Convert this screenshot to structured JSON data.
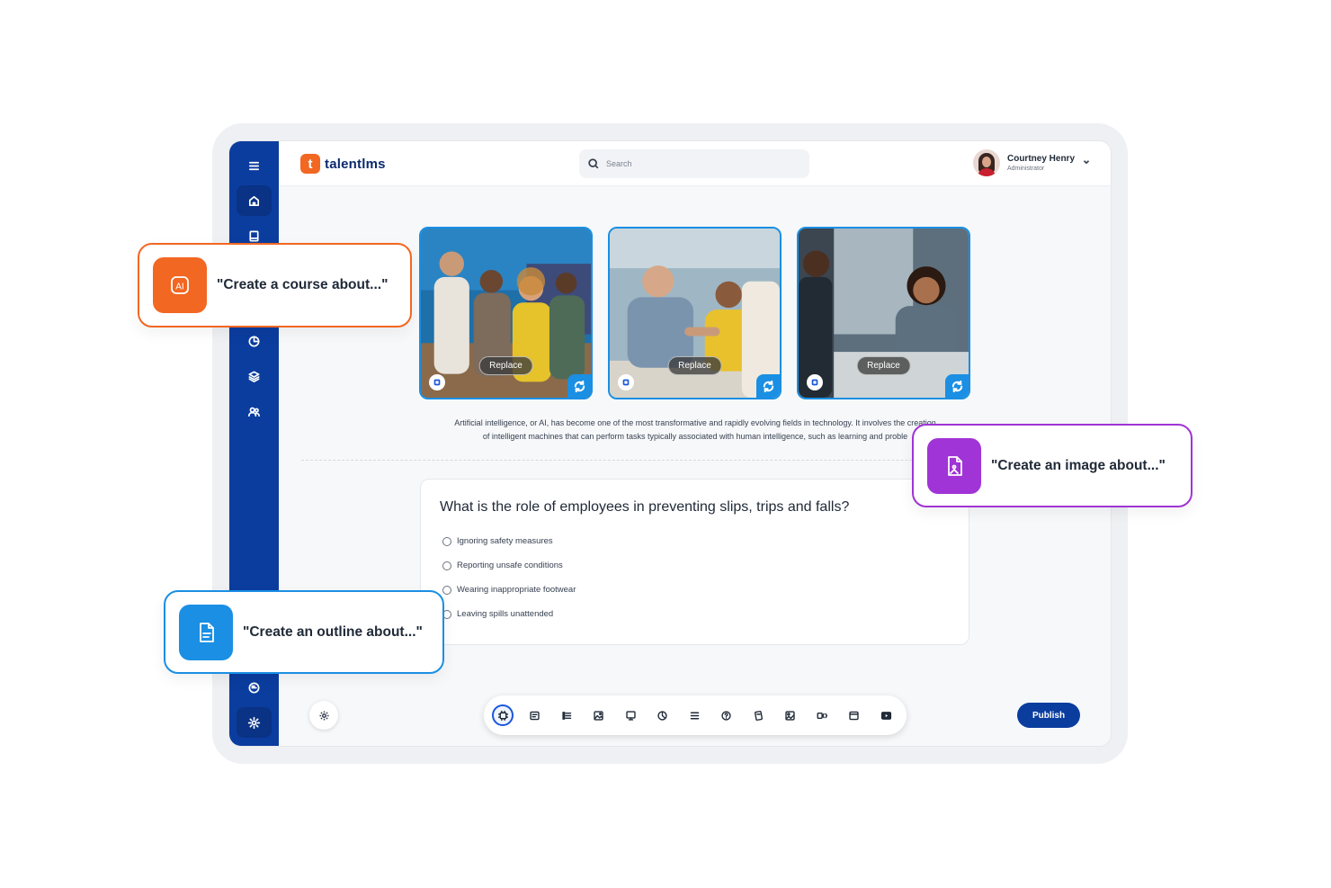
{
  "brand": {
    "name": "talentlms",
    "mark": "t",
    "accent": "#f26722",
    "primary": "#0b3d9f"
  },
  "search": {
    "placeholder": "Search"
  },
  "user": {
    "name": "Courtney Henry",
    "role": "Administrator"
  },
  "sidebar": {
    "items": [
      {
        "icon": "menu-icon"
      },
      {
        "icon": "home-icon",
        "active": true
      },
      {
        "icon": "book-icon"
      },
      {
        "icon": "pie-chart-icon"
      },
      {
        "icon": "layers-icon"
      },
      {
        "icon": "users-icon"
      },
      {
        "icon": "chat-icon"
      },
      {
        "icon": "gear-icon",
        "active": true
      }
    ]
  },
  "images": [
    {
      "replace_label": "Replace"
    },
    {
      "replace_label": "Replace"
    },
    {
      "replace_label": "Replace"
    }
  ],
  "description": {
    "line1": "Artificial intelligence, or AI, has become one of the most transformative and rapidly evolving fields in technology. It involves the creation",
    "line2": "of intelligent machines that can perform tasks typically associated with human intelligence, such as learning and proble"
  },
  "quiz": {
    "question": "What is the role of employees in preventing slips, trips and falls?",
    "options": [
      "Ignoring safety measures",
      "Reporting unsafe conditions",
      "Wearing inappropriate footwear",
      "Leaving spills unattended"
    ]
  },
  "toolbar": {
    "tools": [
      "ai-icon",
      "text-icon",
      "list-icon",
      "image-icon",
      "presentation-icon",
      "chart-icon",
      "divider-icon",
      "question-icon",
      "flashcard-icon",
      "image-gen-icon",
      "embed-icon",
      "browser-icon",
      "video-icon"
    ],
    "publish_label": "Publish"
  },
  "prompts": {
    "course": {
      "text": "\"Create a course about...\"",
      "icon_label": "AI",
      "color": "#f26722"
    },
    "image": {
      "text": "\"Create an image about...\"",
      "color": "#a034d6"
    },
    "outline": {
      "text": "\"Create an outline about...\"",
      "color": "#1a8fe3"
    }
  }
}
